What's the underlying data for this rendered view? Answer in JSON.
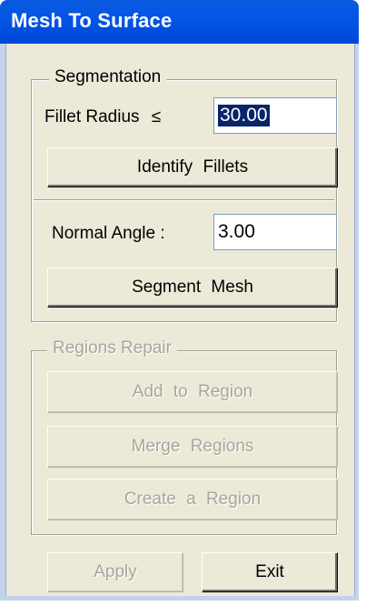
{
  "window": {
    "title": "Mesh To Surface"
  },
  "segmentation": {
    "legend": "Segmentation",
    "fillet_radius_label": "Fillet Radius",
    "fillet_radius_symbol": "≤",
    "fillet_radius_value": "30.00",
    "identify_fillets_label": "Identify  Fillets",
    "normal_angle_label": "Normal Angle :",
    "normal_angle_value": "3.00",
    "segment_mesh_label": "Segment  Mesh"
  },
  "regions_repair": {
    "legend": "Regions Repair",
    "add_to_region_label": "Add  to  Region",
    "merge_regions_label": "Merge  Regions",
    "create_region_label": "Create  a  Region"
  },
  "footer": {
    "apply_label": "Apply",
    "exit_label": "Exit"
  }
}
